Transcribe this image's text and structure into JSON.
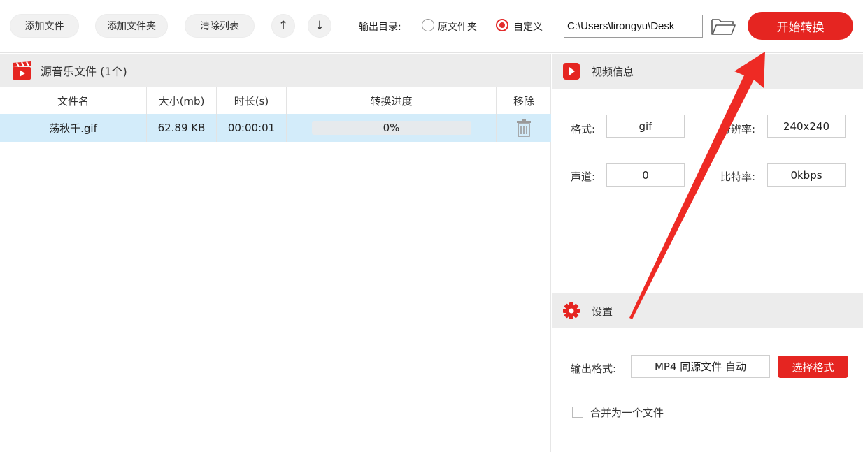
{
  "toolbar": {
    "add_file": "添加文件",
    "add_folder": "添加文件夹",
    "clear_list": "清除列表",
    "move_up": "↑",
    "move_down": "↓",
    "output_label": "输出目录:",
    "radio_original": "原文件夹",
    "radio_custom": "自定义",
    "selected_output": "自定义",
    "output_path": "C:\\Users\\lirongyu\\Desk",
    "start": "开始转换"
  },
  "file_list": {
    "title": "源音乐文件 (1个)",
    "columns": [
      "文件名",
      "大小(mb)",
      "时长(s)",
      "转换进度",
      "移除"
    ],
    "rows": [
      {
        "name": "荡秋千.gif",
        "size": "62.89 KB",
        "duration": "00:00:01",
        "progress_text": "0%",
        "progress": 0
      }
    ]
  },
  "video_info": {
    "title": "视频信息",
    "format_label": "格式:",
    "format_value": "gif",
    "resolution_label": "分辨率:",
    "resolution_value": "240x240",
    "channel_label": "声道:",
    "channel_value": "0",
    "bitrate_label": "比特率:",
    "bitrate_value": "0kbps"
  },
  "settings": {
    "title": "设置",
    "output_format_label": "输出格式:",
    "output_format_value": "MP4 同源文件 自动",
    "choose_format": "选择格式",
    "merge_label": "合并为一个文件",
    "merge_checked": false
  },
  "colors": {
    "accent": "#e52521",
    "row_highlight": "#d3ecfa",
    "header_bg": "#ececec"
  }
}
